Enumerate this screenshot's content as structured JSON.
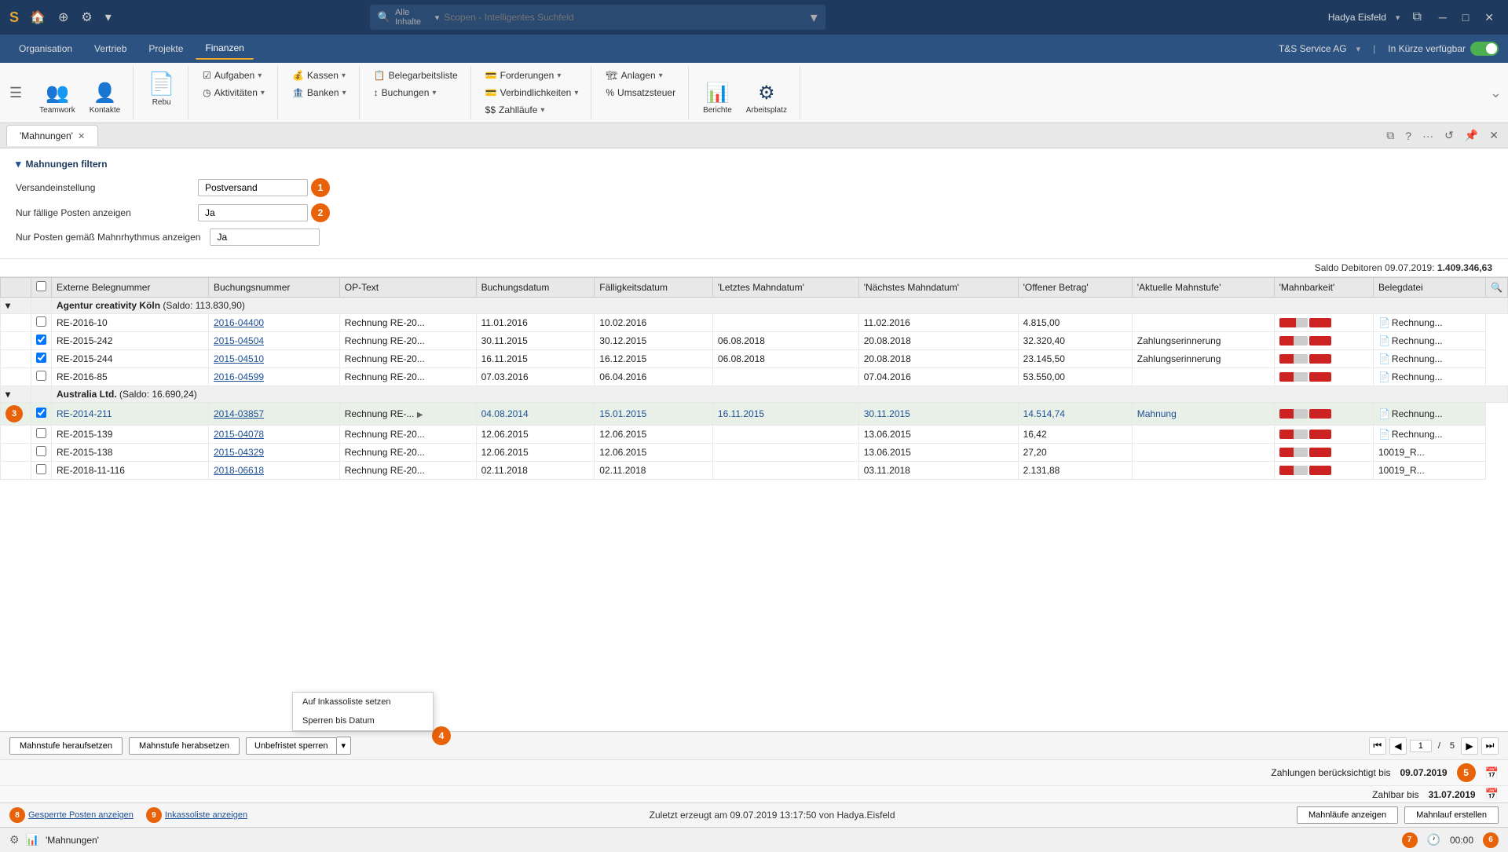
{
  "titlebar": {
    "logo": "S",
    "search_placeholder": "Scopen - Intelligentes Suchfeld",
    "search_filter": "Alle Inhalte",
    "user": "Hadya Eisfeld",
    "company": "T&S Service AG"
  },
  "menubar": {
    "items": [
      "Organisation",
      "Vertrieb",
      "Projekte",
      "Finanzen"
    ],
    "active": "Finanzen",
    "soon_label": "In Kürze verfügbar"
  },
  "ribbon": {
    "teamwork_label": "Teamwork",
    "kontakte_label": "Kontakte",
    "rebu_label": "Rebu",
    "aufgaben_label": "Aufgaben",
    "aktivitaten_label": "Aktivitäten",
    "kassen_label": "Kassen",
    "banken_label": "Banken",
    "belegarbeitsliste_label": "Belegarbeitsliste",
    "buchungen_label": "Buchungen",
    "forderungen_label": "Forderungen",
    "verbindlichkeiten_label": "Verbindlichkeiten",
    "zahllaufe_label": "Zahlläufe",
    "anlagen_label": "Anlagen",
    "umsatzsteuer_label": "Umsatzsteuer",
    "berichte_label": "Berichte",
    "arbeitsplatz_label": "Arbeitsplatz"
  },
  "tab": {
    "title": "'Mahnungen'"
  },
  "filter": {
    "title": "Mahnungen filtern",
    "versand_label": "Versandeinstellung",
    "versand_value": "Postversand",
    "fallige_label": "Nur fällige Posten anzeigen",
    "fallige_value": "Ja",
    "rhythmus_label": "Nur Posten gemäß Mahnrhythmus anzeigen",
    "rhythmus_value": "Ja",
    "saldo_label": "Saldo Debitoren 09.07.2019:",
    "saldo_value": "1.409.346,63"
  },
  "table": {
    "columns": [
      "",
      "",
      "Externe Belegnummer",
      "Buchungsnummer",
      "OP-Text",
      "Buchungsdatum",
      "Fälligkeitsdatum",
      "'Letztes Mahndatum'",
      "'Nächstes Mahndatum'",
      "'Offener Betrag'",
      "'Aktuelle Mahnstufe'",
      "'Mahnbarkeit'",
      "Belegdatei"
    ],
    "groups": [
      {
        "name": "Agentur creativity Köln",
        "saldo": "(Saldo: 113.830,90)",
        "rows": [
          {
            "id": "RE-2016-10",
            "buchnum": "2016-04400",
            "optext": "Rechnung RE-20...",
            "buchdat": "11.01.2016",
            "falldat": "10.02.2016",
            "letztmahn": "",
            "naechmahn": "11.02.2016",
            "betrag": "4.815,00",
            "stufe": "",
            "mahnbar": "",
            "file": "Rechnung...",
            "checked": false
          },
          {
            "id": "RE-2015-242",
            "buchnum": "2015-04504",
            "optext": "Rechnung RE-20...",
            "buchdat": "30.11.2015",
            "falldat": "30.12.2015",
            "letztmahn": "06.08.2018",
            "naechmahn": "20.08.2018",
            "betrag": "32.320,40",
            "stufe": "Zahlungserinnerung",
            "mahnbar": "",
            "file": "Rechnung...",
            "checked": true
          },
          {
            "id": "RE-2015-244",
            "buchnum": "2015-04510",
            "optext": "Rechnung RE-20...",
            "buchdat": "16.11.2015",
            "falldat": "16.12.2015",
            "letztmahn": "06.08.2018",
            "naechmahn": "20.08.2018",
            "betrag": "23.145,50",
            "stufe": "Zahlungserinnerung",
            "mahnbar": "",
            "file": "Rechnung...",
            "checked": true
          },
          {
            "id": "RE-2016-85",
            "buchnum": "2016-04599",
            "optext": "Rechnung RE-20...",
            "buchdat": "07.03.2016",
            "falldat": "06.04.2016",
            "letztmahn": "",
            "naechmahn": "07.04.2016",
            "betrag": "53.550,00",
            "stufe": "",
            "mahnbar": "",
            "file": "Rechnung...",
            "checked": false
          }
        ]
      },
      {
        "name": "Australia Ltd.",
        "saldo": "(Saldo: 16.690,24)",
        "rows": [
          {
            "id": "RE-2014-211",
            "buchnum": "2014-03857",
            "optext": "Rechnung RE-...",
            "buchdat": "04.08.2014",
            "falldat": "15.01.2015",
            "letztmahn": "16.11.2015",
            "naechmahn": "30.11.2015",
            "betrag": "14.514,74",
            "stufe": "Mahnung",
            "mahnbar": "",
            "file": "Rechnung...",
            "checked": true,
            "badge": "3",
            "has_arrow": true
          },
          {
            "id": "RE-2015-139",
            "buchnum": "2015-04078",
            "optext": "Rechnung RE-20...",
            "buchdat": "12.06.2015",
            "falldat": "12.06.2015",
            "letztmahn": "",
            "naechmahn": "13.06.2015",
            "betrag": "16,42",
            "stufe": "",
            "mahnbar": "",
            "file": "Rechnung...",
            "checked": false
          },
          {
            "id": "RE-2015-138",
            "buchnum": "2015-04329",
            "optext": "Rechnung RE-20...",
            "buchdat": "12.06.2015",
            "falldat": "12.06.2015",
            "letztmahn": "",
            "naechmahn": "13.06.2015",
            "betrag": "27,20",
            "stufe": "",
            "mahnbar": "",
            "file": "10019_R...",
            "checked": false
          },
          {
            "id": "RE-2018-11-116",
            "buchnum": "2018-06618",
            "optext": "Rechnung RE-20...",
            "buchdat": "02.11.2018",
            "falldat": "02.11.2018",
            "letztmahn": "",
            "naechmahn": "03.11.2018",
            "betrag": "2.131,88",
            "stufe": "",
            "mahnbar": "",
            "file": "10019_R...",
            "checked": false
          }
        ]
      }
    ]
  },
  "bottom_toolbar": {
    "btn_heraufsetzen": "Mahnstufe heraufsetzen",
    "btn_herabsetzen": "Mahnstufe herabsetzen",
    "btn_sperren": "Unbefristet sperren",
    "dropdown_items": [
      "Auf Inkassoliste setzen",
      "Sperren bis Datum"
    ],
    "page_current": "1",
    "page_total": "5"
  },
  "payments": {
    "zahlungen_label": "Zahlungen berücksichtigt bis",
    "zahlungen_date": "09.07.2019",
    "zahlbar_label": "Zahlbar bis",
    "zahlbar_date": "31.07.2019"
  },
  "bottom_actions": {
    "gesperrte_label": "Gesperrte Posten anzeigen",
    "inkasso_label": "Inkassoliste anzeigen",
    "status_text": "Zuletzt erzeugt am 09.07.2019 13:17:50 von Hadya.Eisfeld",
    "btn_mahnlaufe": "Mahnläufe anzeigen",
    "btn_mahnlauf_erstellen": "Mahnlauf erstellen",
    "badge_8": "8",
    "badge_9": "9",
    "badge_5": "5",
    "badge_6": "6",
    "badge_7": "7"
  },
  "statusbar": {
    "tab_label": "'Mahnungen'",
    "time": "00:00"
  }
}
